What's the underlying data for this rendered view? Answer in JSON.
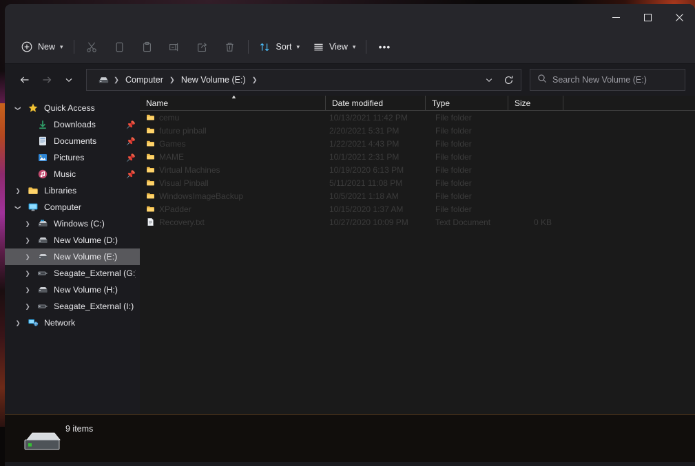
{
  "window": {
    "controls": [
      {
        "name": "minimize",
        "glyph": "minimize-icon"
      },
      {
        "name": "maximize",
        "glyph": "maximize-icon"
      },
      {
        "name": "close",
        "glyph": "close-icon"
      }
    ]
  },
  "toolbar": {
    "new_label": "New",
    "sort_label": "Sort",
    "view_label": "View",
    "more_label": "•••",
    "actions": [
      {
        "name": "cut-button",
        "icon": "scissors-icon",
        "enabled": false
      },
      {
        "name": "copy-button",
        "icon": "copy-icon",
        "enabled": false
      },
      {
        "name": "paste-button",
        "icon": "paste-icon",
        "enabled": false
      },
      {
        "name": "rename-button",
        "icon": "rename-icon",
        "enabled": false
      },
      {
        "name": "share-button",
        "icon": "share-icon",
        "enabled": false
      },
      {
        "name": "delete-button",
        "icon": "trash-icon",
        "enabled": false
      }
    ]
  },
  "address": {
    "back": "back-arrow-icon",
    "forward": "forward-arrow-icon",
    "recent": "chevron-down-icon",
    "drive_icon": "drive-icon",
    "crumbs": [
      "Computer",
      "New Volume (E:)"
    ],
    "dropdown": "chevron-down-icon",
    "refresh": "refresh-icon"
  },
  "search": {
    "placeholder": "Search New Volume (E:)",
    "icon": "search-icon"
  },
  "sidebar": {
    "items": [
      {
        "label": "Quick Access",
        "icon": "star-icon",
        "indent": 0,
        "twisty": "expanded",
        "pinned": false,
        "selected": false
      },
      {
        "label": "Downloads",
        "icon": "downloads-icon",
        "indent": 1,
        "twisty": "none",
        "pinned": true,
        "selected": false
      },
      {
        "label": "Documents",
        "icon": "documents-icon",
        "indent": 1,
        "twisty": "none",
        "pinned": true,
        "selected": false
      },
      {
        "label": "Pictures",
        "icon": "pictures-icon",
        "indent": 1,
        "twisty": "none",
        "pinned": true,
        "selected": false
      },
      {
        "label": "Music",
        "icon": "music-icon",
        "indent": 1,
        "twisty": "none",
        "pinned": true,
        "selected": false
      },
      {
        "label": "Libraries",
        "icon": "folder-icon",
        "indent": 0,
        "twisty": "collapsed",
        "pinned": false,
        "selected": false
      },
      {
        "label": "Computer",
        "icon": "computer-icon",
        "indent": 0,
        "twisty": "expanded",
        "pinned": false,
        "selected": false
      },
      {
        "label": "Windows (C:)",
        "icon": "windows-drive-icon",
        "indent": 1,
        "twisty": "collapsed",
        "pinned": false,
        "selected": false
      },
      {
        "label": "New Volume (D:)",
        "icon": "drive-icon",
        "indent": 1,
        "twisty": "collapsed",
        "pinned": false,
        "selected": false
      },
      {
        "label": "New Volume (E:)",
        "icon": "drive-icon",
        "indent": 1,
        "twisty": "collapsed",
        "pinned": false,
        "selected": true
      },
      {
        "label": "Seagate_External (G:)",
        "icon": "external-drive-icon",
        "indent": 1,
        "twisty": "collapsed",
        "pinned": false,
        "selected": false
      },
      {
        "label": "New Volume (H:)",
        "icon": "drive-icon",
        "indent": 1,
        "twisty": "collapsed",
        "pinned": false,
        "selected": false
      },
      {
        "label": "Seagate_External (I:)",
        "icon": "external-drive-icon",
        "indent": 1,
        "twisty": "collapsed",
        "pinned": false,
        "selected": false
      },
      {
        "label": "Network",
        "icon": "network-icon",
        "indent": 0,
        "twisty": "collapsed",
        "pinned": false,
        "selected": false
      }
    ]
  },
  "filelist": {
    "columns": [
      "Name",
      "Date modified",
      "Type",
      "Size"
    ],
    "sort_column": "Name",
    "sort_direction": "ascending",
    "rows": [
      {
        "name": "cemu",
        "date": "10/13/2021 11:42 PM",
        "type": "File folder",
        "size": "",
        "icon": "folder-icon"
      },
      {
        "name": "future pinball",
        "date": "2/20/2021 5:31 PM",
        "type": "File folder",
        "size": "",
        "icon": "folder-icon"
      },
      {
        "name": "Games",
        "date": "1/22/2021 4:43 PM",
        "type": "File folder",
        "size": "",
        "icon": "folder-icon"
      },
      {
        "name": "MAME",
        "date": "10/1/2021 2:31 PM",
        "type": "File folder",
        "size": "",
        "icon": "folder-icon"
      },
      {
        "name": "Virtual Machines",
        "date": "10/19/2020 6:13 PM",
        "type": "File folder",
        "size": "",
        "icon": "folder-icon"
      },
      {
        "name": "Visual Pinball",
        "date": "5/11/2021 11:08 PM",
        "type": "File folder",
        "size": "",
        "icon": "folder-icon"
      },
      {
        "name": "WindowsImageBackup",
        "date": "10/5/2021 1:18 AM",
        "type": "File folder",
        "size": "",
        "icon": "folder-icon"
      },
      {
        "name": "XPadder",
        "date": "10/15/2020 1:37 AM",
        "type": "File folder",
        "size": "",
        "icon": "folder-icon"
      },
      {
        "name": "Recovery.txt",
        "date": "10/27/2020 10:09 PM",
        "type": "Text Document",
        "size": "0 KB",
        "icon": "text-document-icon"
      }
    ]
  },
  "statusbar": {
    "item_count": "9 items",
    "drive_icon": "drive-badge-icon"
  },
  "colors": {
    "window_bg": "#1b1b1f",
    "toolbar_bg": "#26262b",
    "filepane_bg": "#1a1a1a",
    "selection": "#58585c",
    "folder": "#e8b33c",
    "accent": "#4cc2ff"
  }
}
